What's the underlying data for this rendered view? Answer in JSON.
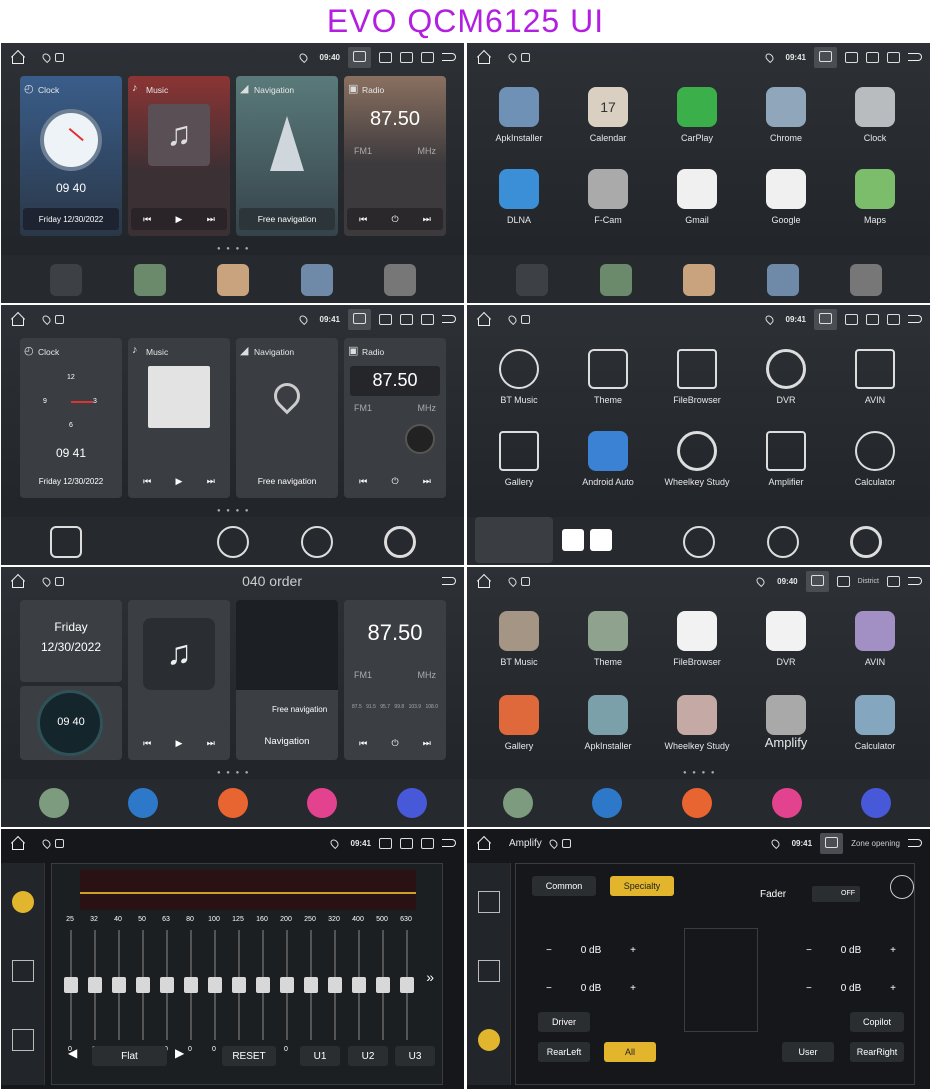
{
  "header": {
    "title": "EVO QCM6125 UI"
  },
  "status": {
    "t1": "09:40",
    "t2": "09:41",
    "t3": "09:41",
    "t4": "09:41",
    "t5": "09:41",
    "t6": "09:40",
    "t7": "09:41",
    "t8": "09:41"
  },
  "p1": {
    "clock_title": "Clock",
    "time": "09 40",
    "date": "Friday   12/30/2022",
    "music_title": "Music",
    "nav_title": "Navigation",
    "nav_btn": "Free navigation",
    "radio_title": "Radio",
    "freq": "87.50",
    "band": "FM1",
    "unit": "MHz"
  },
  "p2": {
    "apps": [
      "ApkInstaller",
      "Calendar",
      "CarPlay",
      "Chrome",
      "Clock",
      "DLNA",
      "F-Cam",
      "Gmail",
      "Google",
      "Maps"
    ],
    "cal_num": "17"
  },
  "p3": {
    "clock_title": "Clock",
    "time": "09 41",
    "date": "Friday   12/30/2022",
    "music_title": "Music",
    "nav_title": "Navigation",
    "nav_btn": "Free navigation",
    "radio_title": "Radio",
    "freq": "87.50",
    "band": "FM1",
    "unit": "MHz",
    "d12": "12",
    "d3": "3",
    "d6": "6",
    "d9": "9"
  },
  "p4": {
    "apps": [
      "BT Music",
      "Theme",
      "FileBrowser",
      "DVR",
      "AVIN",
      "Gallery",
      "Android Auto",
      "Wheelkey Study",
      "Amplifier",
      "Calculator"
    ]
  },
  "p5": {
    "overlay": "040 order",
    "day": "Friday",
    "date": "12/30/2022",
    "time": "09 40",
    "nav_free": "Free navigation",
    "nav": "Navigation",
    "freq": "87.50",
    "band": "FM1",
    "unit": "MHz",
    "scale": [
      "87.5",
      "91.5",
      "95.7",
      "99.8",
      "103.9",
      "108.0"
    ]
  },
  "p6": {
    "overlay": "District",
    "apps": [
      "BT Music",
      "Theme",
      "FileBrowser",
      "DVR",
      "AVIN",
      "Gallery",
      "ApkInstaller",
      "Wheelkey Study",
      "Amplify",
      "Calculator"
    ]
  },
  "p7": {
    "bands": [
      "25",
      "32",
      "40",
      "50",
      "63",
      "80",
      "100",
      "125",
      "160",
      "200",
      "250",
      "320",
      "400",
      "500",
      "630"
    ],
    "levels": [
      0,
      0,
      0,
      0,
      0,
      0,
      0,
      0,
      0,
      0,
      0,
      0,
      0,
      0,
      0
    ],
    "values": [
      "0",
      "0",
      "0",
      "0",
      "0",
      "0",
      "0",
      "0",
      "0",
      "0",
      "0",
      "0",
      "0",
      "0",
      "0"
    ],
    "preset": "Flat",
    "reset": "RESET",
    "u1": "U1",
    "u2": "U2",
    "u3": "U3"
  },
  "p8": {
    "title": "Amplify",
    "overlay": "Zone opening",
    "common": "Common",
    "specialty": "Specialty",
    "fader": "Fader",
    "off": "OFF",
    "db": [
      "0 dB",
      "0 dB",
      "0 dB",
      "0 dB"
    ],
    "driver": "Driver",
    "copilot": "Copilot",
    "rearleft": "RearLeft",
    "all": "All",
    "user": "User",
    "rearright": "RearRight"
  }
}
